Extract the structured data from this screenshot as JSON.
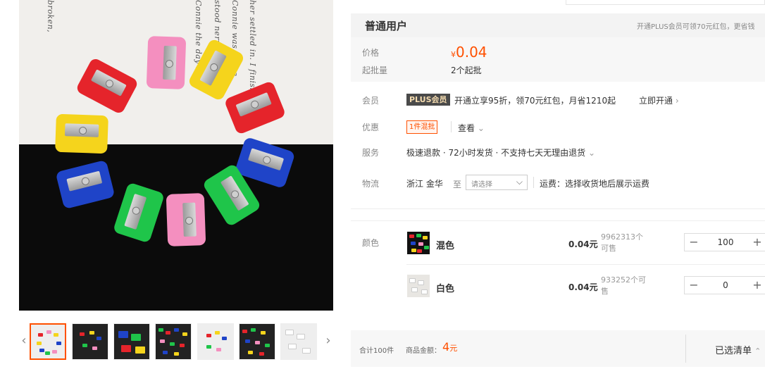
{
  "product_images": {
    "main_alt": "",
    "script_lines": [
      "broken,",
      "Connie the day she",
      "stood nervous",
      "Connie was in the",
      "her settled in. I finished it"
    ],
    "nav_prev": "‹",
    "nav_next": "›",
    "thumbnail_count": 7
  },
  "pricing": {
    "user_type": "普通用户",
    "plus_tip": "开通PLUS会员可领70元红包，更省钱",
    "price_label": "价格",
    "currency": "¥",
    "price": "0.04",
    "moq_label": "起批量",
    "moq_value": "2个起批"
  },
  "member": {
    "label": "会员",
    "badge": "PLUS会员",
    "text": "开通立享95折，领70元红包，月省1210起",
    "link": "立即开通",
    "link_arrow": "›"
  },
  "discount": {
    "label": "优惠",
    "badge": "1件混批",
    "view": "查看",
    "view_arrow": "⌄"
  },
  "service": {
    "label": "服务",
    "text": "极速退款 · 72小时发货 · 不支持七天无理由退货",
    "arrow": "⌄"
  },
  "logistics": {
    "label": "物流",
    "from": "浙江  金华",
    "to": "至",
    "select_placeholder": "请选择",
    "select_arrow": "⌵",
    "shipping": "运费：选择收货地后展示运费"
  },
  "sku": {
    "label": "颜色",
    "items": [
      {
        "name": "混色",
        "price": "0.04元",
        "stock": "9962313个可售",
        "qty": "100"
      },
      {
        "name": "白色",
        "price": "0.04元",
        "stock": "933252个可售",
        "qty": "0"
      }
    ],
    "minus": "−",
    "plus": "+"
  },
  "footer": {
    "count": "合计100件",
    "amount_label": "商品金额：",
    "amount": "4",
    "amount_unit": "元",
    "selected_list": "已选清单",
    "selected_arrow": "⌃"
  },
  "colors": {
    "accent": "#ff5000",
    "header_bg": "#f3f3f3",
    "panel_bg": "#f7f7f7",
    "plus_badge_bg": "#4a4a4a"
  }
}
